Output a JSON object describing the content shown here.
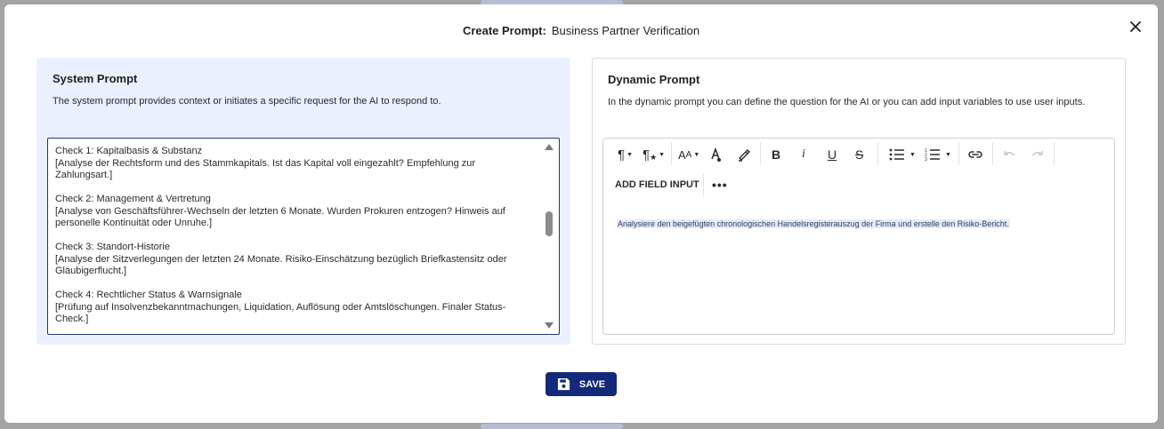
{
  "modal": {
    "title_label": "Create Prompt:",
    "title_value": "Business Partner Verification"
  },
  "system_prompt": {
    "title": "System Prompt",
    "description": "The system prompt provides context or initiates a specific request for the AI to respond to.",
    "checks": [
      {
        "title": "Check 1: Kapitalbasis & Substanz",
        "desc": "[Analyse der Rechtsform und des Stammkapitals. Ist das Kapital voll eingezahlt? Empfehlung zur Zahlungsart.]"
      },
      {
        "title": "Check 2: Management & Vertretung",
        "desc": "[Analyse von Geschäftsführer-Wechseln der letzten 6 Monate. Wurden Prokuren entzogen? Hinweis auf personelle Kontinuität oder Unruhe.]"
      },
      {
        "title": "Check 3: Standort-Historie",
        "desc": "[Analyse der Sitzverlegungen der letzten 24 Monate. Risiko-Einschätzung bezüglich Briefkastensitz oder Gläubigerflucht.]"
      },
      {
        "title": "Check 4: Rechtlicher Status & Warnsignale",
        "desc": "[Prüfung auf Insolvenzbekanntmachungen, Liquidation, Auflösung oder Amtslöschungen. Finaler Status-Check.]"
      }
    ]
  },
  "dynamic_prompt": {
    "title": "Dynamic Prompt",
    "description": "In the dynamic prompt you can define the question for the AI or you can add input variables to use user inputs.",
    "add_field_label": "ADD FIELD INPUT",
    "more_label": "•••",
    "content": "Analysiere den beigefügten chronologischen Handelsregisterauszug der Firma und erstelle den Risiko-Bericht."
  },
  "toolbar_icons": [
    "paragraph-format-icon",
    "paragraph-style-icon",
    "font-size-icon",
    "text-color-icon",
    "highlight-icon",
    "bold-icon",
    "italic-icon",
    "underline-icon",
    "strikethrough-icon",
    "unordered-list-icon",
    "ordered-list-icon",
    "link-icon",
    "undo-icon",
    "redo-icon"
  ],
  "save_label": "SAVE",
  "colors": {
    "primary": "#13297a",
    "system_panel_bg": "#eaf0fd",
    "textarea_border": "#26376b"
  }
}
